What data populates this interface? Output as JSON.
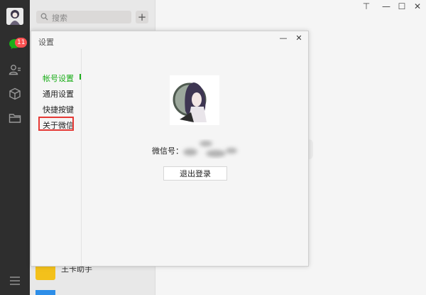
{
  "nav": {
    "chat_badge": "11",
    "icons": [
      "chat-icon",
      "contacts-icon",
      "favorites-box-icon",
      "files-folder-icon",
      "menu-icon"
    ]
  },
  "chat_list": {
    "search_placeholder": "搜索",
    "add_label": "+",
    "partial_item_name": "王卡助手"
  },
  "window_controls": {
    "pin": "⊤",
    "minimize": "—",
    "maximize": "☐",
    "close": "✕"
  },
  "settings_dialog": {
    "title": "设置",
    "minimize": "—",
    "close": "✕",
    "menu": [
      {
        "label": "帐号设置",
        "active": true
      },
      {
        "label": "通用设置",
        "active": false
      },
      {
        "label": "快捷按键",
        "active": false
      },
      {
        "label": "关于微信",
        "active": false,
        "highlighted": true
      }
    ],
    "wechat_id_label": "微信号：",
    "logout_label": "退出登录"
  },
  "colors": {
    "accent": "#1aad19",
    "badge": "#fa5151",
    "highlight_box": "#e53935",
    "nav_bg": "#2e2e2e"
  }
}
